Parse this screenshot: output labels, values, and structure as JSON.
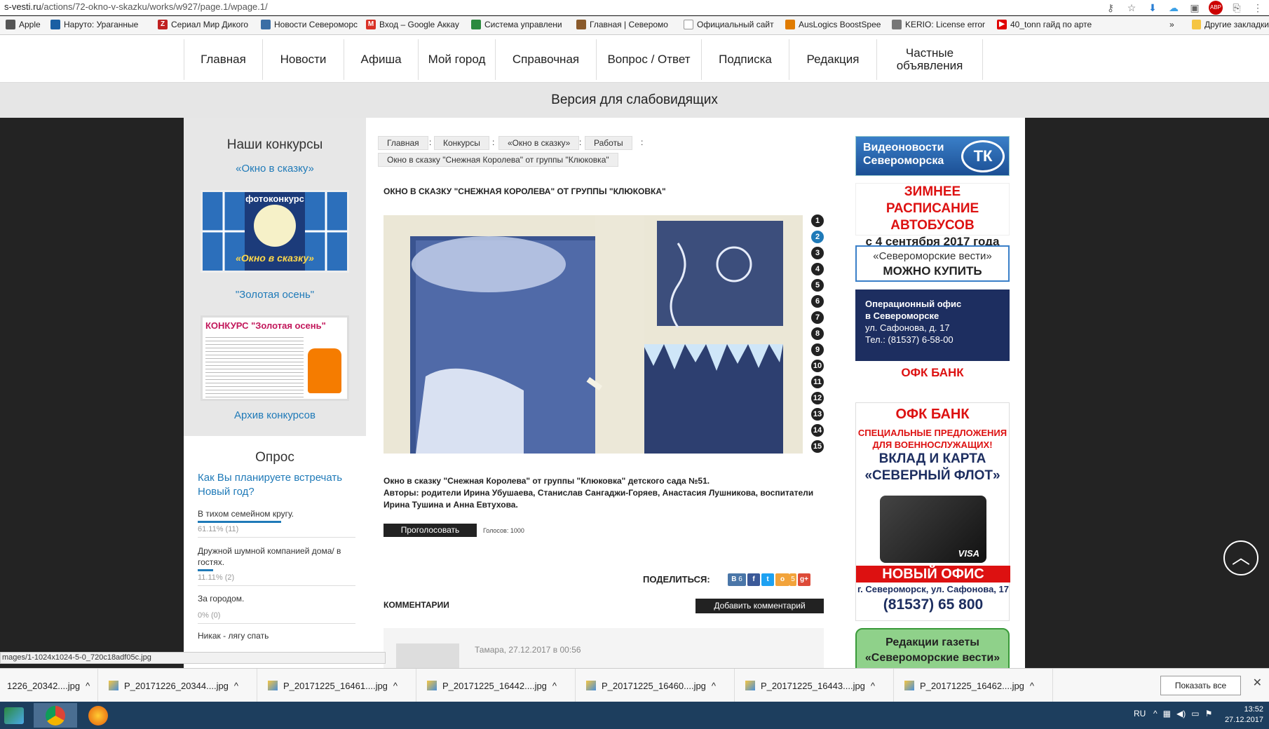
{
  "browser": {
    "url_host": "s-vesti.ru",
    "url_path": "/actions/72-okno-v-skazku/works/w927/page.1/wpage.1/",
    "bookmarks": [
      {
        "label": "Apple",
        "color": "#555"
      },
      {
        "label": "Наруто: Ураганные",
        "color": "#1a5fa3"
      },
      {
        "label": "Сериал Мир Дикого",
        "color": "#c02020"
      },
      {
        "label": "Новости Североморс",
        "color": "#3a6ea5"
      },
      {
        "label": "Вход – Google Аккау",
        "color": "#d93025"
      },
      {
        "label": "Система управлени",
        "color": "#2b8a3e"
      },
      {
        "label": "Главная | Северомо",
        "color": "#8a5a2b"
      },
      {
        "label": "Официальный сайт",
        "color": "#999"
      },
      {
        "label": "AusLogics BoostSpee",
        "color": "#e07b00"
      },
      {
        "label": "KERIO: License error",
        "color": "#777"
      },
      {
        "label": "40_tonn гайд по арте",
        "color": "#e00000"
      }
    ],
    "bookmarks_more": "»",
    "other_bookmarks": "Другие закладки"
  },
  "nav": {
    "items": [
      "Главная",
      "Новости",
      "Афиша",
      "Мой город",
      "Справочная",
      "Вопрос / Ответ",
      "Подписка",
      "Редакция",
      "Частные объявления"
    ]
  },
  "accessibility": "Версия для слабовидящих",
  "left": {
    "contests_title": "Наши конкурсы",
    "contest1_link": "«Окно в сказку»",
    "contest1_thumb_top": "фотоконкурс",
    "contest1_thumb_bottom": "«Окно в сказку»",
    "contest2_link": "\"Золотая осень\"",
    "contest2_thumb_title": "КОНКУРС \"Золотая осень\"",
    "archive_link": "Архив конкурсов",
    "poll_title": "Опрос",
    "poll_question": "Как Вы планируете встречать Новый год?",
    "poll_options": [
      {
        "label": "В тихом семейном кругу.",
        "result": "61.11% (11)",
        "percent": 61.11
      },
      {
        "label": "Дружной шумной компанией дома/ в гостях.",
        "result": "11.11% (2)",
        "percent": 11.11
      },
      {
        "label": "За городом.",
        "result": "0% (0)",
        "percent": 0
      },
      {
        "label": "Никак - лягу спать",
        "result": "",
        "percent": 0
      }
    ]
  },
  "main": {
    "breadcrumbs": [
      "Главная",
      "Конкурсы",
      "«Окно в сказку»",
      "Работы"
    ],
    "breadcrumb_current": "Окно в сказку \"Снежная Королева\" от группы \"Клюковка\"",
    "breadcrumb_sep": ":",
    "title": "ОКНО В СКАЗКУ \"СНЕЖНАЯ КОРОЛЕВА\" ОТ ГРУППЫ \"КЛЮКОВКА\"",
    "pages": [
      "1",
      "2",
      "3",
      "4",
      "5",
      "6",
      "7",
      "8",
      "9",
      "10",
      "11",
      "12",
      "13",
      "14",
      "15"
    ],
    "active_page": "2",
    "desc_line1": "Окно в сказку \"Снежная Королева\" от группы \"Клюковка\" детского сада №51.",
    "desc_line2": "Авторы: родители Ирина Убушаева, Станислав Сангаджи-Горяев, Анастасия Лушникова, воспитатели Ирина Тушина и  Анна Евтухова.",
    "vote_button": "Проголосовать",
    "votes": "Голосов: 1000",
    "share_label": "ПОДЕЛИТЬСЯ:",
    "share_icons": [
      {
        "name": "vk",
        "glyph": "В",
        "color": "#4a76a8"
      },
      {
        "name": "facebook",
        "glyph": "f",
        "color": "#3b5998"
      },
      {
        "name": "twitter",
        "glyph": "t",
        "color": "#1da1f2"
      },
      {
        "name": "odnoklassniki",
        "glyph": "о",
        "color": "#f2a33a"
      },
      {
        "name": "google-plus",
        "glyph": "g+",
        "color": "#dd4b39"
      }
    ],
    "vk_count": "6",
    "ok_count": "5",
    "comments_title": "КОММЕНТАРИИ",
    "add_comment": "Добавить комментарий",
    "comment_author_date": "Тамара, 27.12.2017 в 00:56"
  },
  "right": {
    "ad1_line1": "Видеоновости",
    "ad1_line2": "Североморска",
    "ad1_logo": "ТК",
    "ad2_line1": "ЗИМНЕЕ РАСПИСАНИЕ",
    "ad2_line2": "АВТОБУСОВ",
    "ad2_line3": "с 4 сентября 2017 года",
    "ad3_line1": "«Североморские вести»",
    "ad3_line2": "МОЖНО КУПИТЬ",
    "ad4_line1": "Операционный офис",
    "ad4_line2": "в Североморске",
    "ad4_line3": "ул. Сафонова, д. 17",
    "ad4_line4": "Тел.: (81537) 6-58-00",
    "ad4_bank": "ОФК БАНК",
    "ad5_bank": "ОФК БАНК",
    "ad5_line1": "СПЕЦИАЛЬНЫЕ ПРЕДЛОЖЕНИЯ",
    "ad5_line2": "ДЛЯ ВОЕННОСЛУЖАЩИХ!",
    "ad5_line3": "ВКЛАД И КАРТА",
    "ad5_line4": "«СЕВЕРНЫЙ ФЛОТ»",
    "ad5_card": "VISA",
    "ad5_new": "НОВЫЙ ОФИС",
    "ad5_addr": "г. Североморск, ул. Сафонова, 17",
    "ad5_phone": "(81537) 65 800",
    "ad6_line1": "Редакции газеты",
    "ad6_line2": "«Североморские вести»"
  },
  "status_url": "mages/1-1024x1024-5-0_720c18adf05c.jpg",
  "downloads": [
    "1226_20342....jpg",
    "P_20171226_20344....jpg",
    "P_20171225_16461....jpg",
    "P_20171225_16442....jpg",
    "P_20171225_16460....jpg",
    "P_20171225_16443....jpg",
    "P_20171225_16462....jpg"
  ],
  "show_all": "Показать все",
  "tray": {
    "lang": "RU",
    "time": "13:52",
    "date": "27.12.2017"
  }
}
